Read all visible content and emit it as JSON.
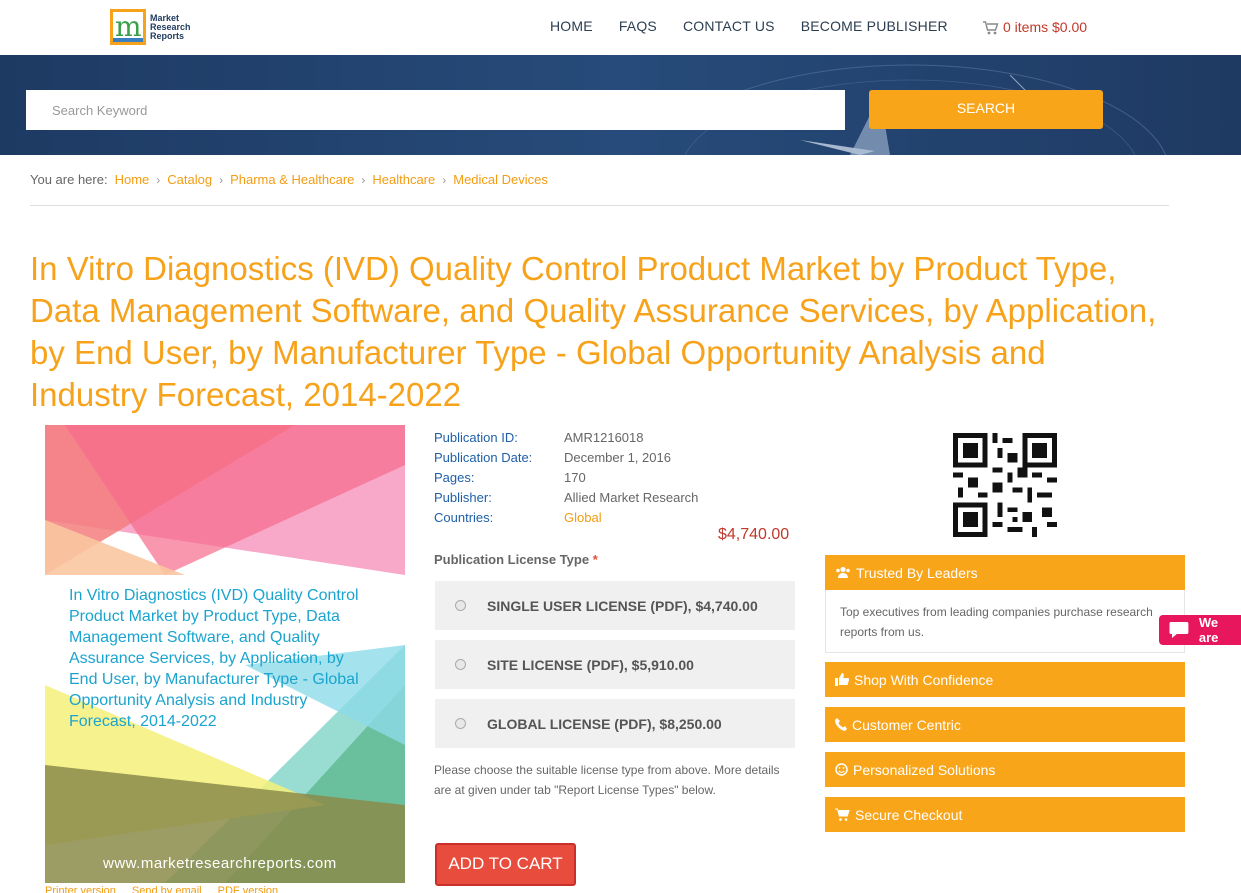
{
  "header": {
    "logo_text_lines": [
      "Market",
      "Research",
      "Reports"
    ],
    "nav": [
      {
        "label": "HOME"
      },
      {
        "label": "FAQS"
      },
      {
        "label": "CONTACT US"
      },
      {
        "label": "BECOME PUBLISHER"
      }
    ],
    "cart_label": "0 items $0.00"
  },
  "search": {
    "placeholder": "Search Keyword",
    "button_label": "SEARCH"
  },
  "breadcrumb": {
    "prefix": "You are here:",
    "items": [
      "Home",
      "Catalog",
      "Pharma & Healthcare",
      "Healthcare",
      "Medical Devices"
    ]
  },
  "product": {
    "title": "In Vitro Diagnostics (IVD) Quality Control Product Market by Product Type, Data Management Software, and Quality Assurance Services, by Application, by End User, by Manufacturer Type - Global Opportunity Analysis and Industry Forecast, 2014-2022",
    "cover_title": "In Vitro Diagnostics (IVD) Quality Control Product Market by Product Type, Data Management Software, and Quality Assurance Services, by Application, by End User, by Manufacturer Type - Global Opportunity Analysis and Industry Forecast, 2014-2022",
    "cover_url": "www.marketresearchreports.com",
    "below_cover_links": [
      "Printer version",
      "Send by email",
      "PDF version"
    ],
    "details": [
      {
        "key": "Publication ID:",
        "value": "AMR1216018"
      },
      {
        "key": "Publication Date:",
        "value": "December 1, 2016"
      },
      {
        "key": "Pages:",
        "value": "170"
      },
      {
        "key": "Publisher:",
        "value": "Allied Market Research"
      },
      {
        "key": "Countries:",
        "value": "Global"
      }
    ],
    "price": "$4,740.00",
    "license_label": "Publication License Type",
    "license_required_mark": "*",
    "licenses": [
      {
        "label": "SINGLE USER LICENSE (PDF), $4,740.00"
      },
      {
        "label": "SITE LICENSE (PDF), $5,910.00"
      },
      {
        "label": "GLOBAL LICENSE (PDF), $8,250.00"
      }
    ],
    "license_note": "Please choose the suitable license type from above. More details are at given under tab \"Report License Types\" below.",
    "add_to_cart_label": "ADD TO CART"
  },
  "features": [
    {
      "label": "Trusted By Leaders",
      "icon": "users-icon"
    },
    {
      "label": "Shop With Confidence",
      "icon": "thumbs-up-icon"
    },
    {
      "label": "Customer Centric",
      "icon": "phone-icon"
    },
    {
      "label": "Personalized Solutions",
      "icon": "smile-icon"
    },
    {
      "label": "Secure Checkout",
      "icon": "cart-icon"
    }
  ],
  "trusted_text": "Top executives from leading companies purchase research reports from us.",
  "chat_label": "We are",
  "colors": {
    "accent": "#f9a51a",
    "title": "#f7a21b",
    "nav_blue": "#1f5fa8",
    "price_red": "#c0392b",
    "cart_button": "#e74c3c",
    "banner": "#1d3a63",
    "chat": "#e8175d"
  }
}
